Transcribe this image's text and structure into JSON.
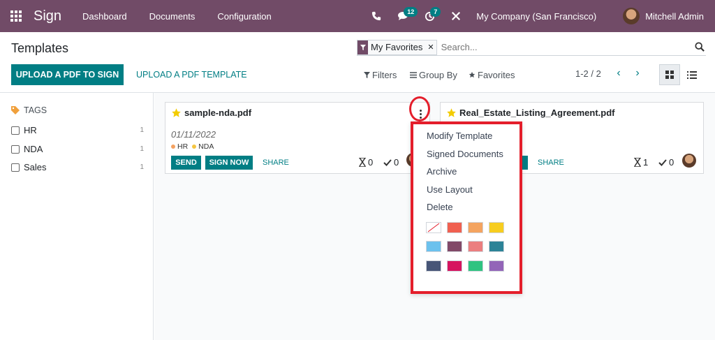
{
  "navbar": {
    "brand": "Sign",
    "menus": [
      "Dashboard",
      "Documents",
      "Configuration"
    ],
    "messages_count": "12",
    "activities_count": "7",
    "company": "My Company (San Francisco)",
    "user": "Mitchell Admin"
  },
  "control": {
    "title": "Templates",
    "facet": "My Favorites",
    "search_placeholder": "Search...",
    "upload_pdf_to_sign": "UPLOAD A PDF TO SIGN",
    "upload_pdf_template": "UPLOAD A PDF TEMPLATE",
    "filters": "Filters",
    "group_by": "Group By",
    "favorites": "Favorites",
    "pager": "1-2 / 2"
  },
  "sidebar": {
    "header": "TAGS",
    "tags": [
      {
        "label": "HR",
        "count": "1"
      },
      {
        "label": "NDA",
        "count": "1"
      },
      {
        "label": "Sales",
        "count": "1"
      }
    ]
  },
  "cards": [
    {
      "title": "sample-nda.pdf",
      "date": "01/11/2022",
      "tags": [
        "HR",
        "NDA"
      ],
      "send": "SEND",
      "sign_now": "SIGN NOW",
      "share": "SHARE",
      "in_progress": "0",
      "signed": "0"
    },
    {
      "title": "Real_Estate_Listing_Agreement.pdf",
      "share": "SHARE",
      "in_progress": "1",
      "signed": "0"
    }
  ],
  "dropdown": {
    "items": [
      "Modify Template",
      "Signed Documents",
      "Archive",
      "Use Layout",
      "Delete"
    ]
  },
  "colors": {
    "brand": "#714b67",
    "accent": "#017e84",
    "highlight": "#e41e2b",
    "favorite": "#f3cc00",
    "tag_hr": "#f4a261",
    "tag_nda": "#f4c542",
    "swatches": [
      "none",
      "#f06050",
      "#f4a460",
      "#f7cd1f",
      "#6cc1ed",
      "#814968",
      "#eb7e7f",
      "#2c8397",
      "#475577",
      "#d6145f",
      "#30c381",
      "#9365b8"
    ]
  }
}
